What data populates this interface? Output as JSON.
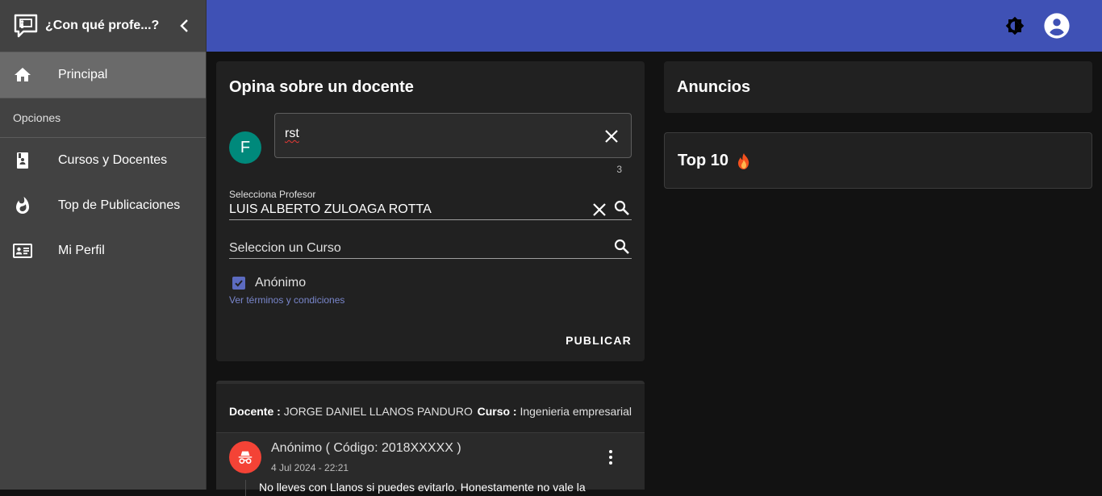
{
  "sidebar": {
    "app_title": "¿Con qué profe...?",
    "items": [
      {
        "label": "Principal",
        "icon": "home-icon",
        "active": true
      },
      {
        "label": "Cursos y Docentes",
        "icon": "book-icon"
      },
      {
        "label": "Top de Publicaciones",
        "icon": "fire-icon"
      },
      {
        "label": "Mi Perfil",
        "icon": "id-card-icon"
      }
    ],
    "subheader": "Opciones"
  },
  "appbar": {
    "theme_icon": "brightness-icon",
    "account_icon": "account-circle-icon",
    "color": "#3f51b5"
  },
  "opina": {
    "title": "Opina sobre un docente",
    "avatar_letter": "F",
    "avatar_color": "#00897b",
    "text_value": "rst",
    "counter": "3",
    "profesor_label": "Selecciona Profesor",
    "profesor_value": "LUIS ALBERTO ZULOAGA ROTTA",
    "curso_placeholder": "Seleccion un Curso",
    "anonimo_label": "Anónimo",
    "anonimo_checked": true,
    "terms_link": "Ver términos y condiciones",
    "publish_label": "PUBLICAR"
  },
  "anuncios": {
    "title": "Anuncios"
  },
  "top10": {
    "title": "Top 10",
    "icon": "fire-icon"
  },
  "post": {
    "docente_label": "Docente :",
    "docente_value": "JORGE DANIEL LLANOS PANDURO",
    "curso_label": "Curso :",
    "curso_value": "Ingenieria empresarial",
    "author": "Anónimo ( Código: 2018XXXXX )",
    "date": "4 Jul 2024 - 22:21",
    "text": "No lleves con Llanos si puedes evitarlo. Honestamente no vale la",
    "avatar_icon": "incognito-icon",
    "avatar_color": "#f44336"
  }
}
